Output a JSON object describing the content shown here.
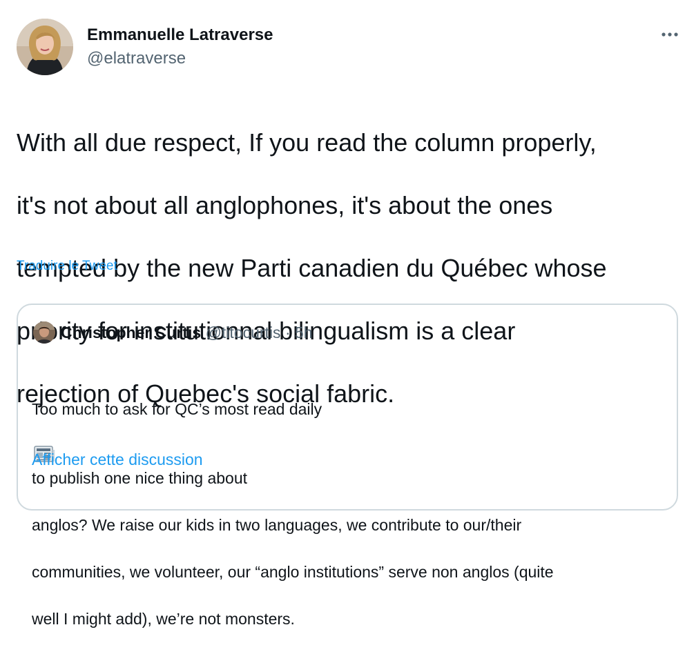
{
  "tweet": {
    "author": {
      "name": "Emmanuelle Latraverse",
      "handle": "@elatraverse"
    },
    "more_icon": "more-dots-icon",
    "text_lines": [
      "With all due respect, If you read the column properly,",
      "it's not about all anglophones, it's about the ones",
      "tempted by the new Parti canadien du Québec whose",
      "priority for institutionnal bilingualism is a clear",
      "rejection of Quebec's social fabric."
    ],
    "translate_label": "Traduire le Tweet"
  },
  "quote": {
    "author_name": "Christopher Curtis",
    "author_handle": "@titocurtis",
    "separator": "·",
    "time": "5h",
    "text_before_icon": "Too much to ask for QC’s most read daily",
    "icon": "newspaper-icon",
    "text_after_icon": "to publish one nice thing about",
    "text_lines": [
      "anglos? We raise our kids in two languages, we contribute to our/their",
      "communities, we volunteer, our “anglo institutions” serve non anglos (quite",
      "well I might add), we’re not monsters."
    ],
    "show_thread_label": "Afficher cette discussion"
  },
  "colors": {
    "link": "#1d9bf0",
    "secondary_text": "#536471",
    "primary_text": "#0f1419",
    "card_border": "#cfd9de"
  }
}
